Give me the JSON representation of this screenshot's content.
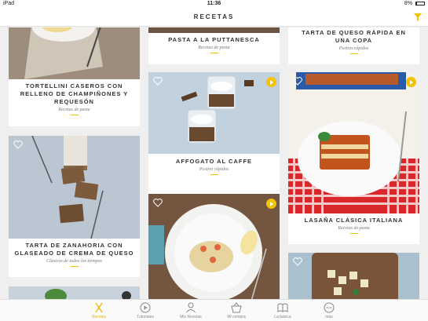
{
  "status": {
    "carrier": "iPad",
    "time": "11:36",
    "battery": "8%"
  },
  "nav": {
    "title": "RECETAS"
  },
  "cards": [
    {
      "title": "TORTELLINI CASEROS CON RELLENO DE CHAMPIÑONES Y REQUESÓN",
      "category": "Recetas de pasta"
    },
    {
      "title": "TARTA DE ZANAHORIA CON GLASEADO DE CREMA DE QUESO",
      "category": "Clásicos de todos los tiempos"
    },
    {
      "title": "PASTA A LA PUTTANESCA",
      "category": "Recetas de pasta"
    },
    {
      "title": "AFFOGATO AL CAFFE",
      "category": "Postres rápidos"
    },
    {
      "title": "TARTA DE QUESO RÁPIDA EN UNA COPA",
      "category": "Postres rápidos"
    },
    {
      "title": "LASAÑA CLÁSICA ITALIANA",
      "category": "Recetas de pasta"
    }
  ],
  "tabs": [
    {
      "label": "Recetas",
      "icon": "fork-knife-icon",
      "active": true
    },
    {
      "label": "Tutoriales",
      "icon": "play-icon"
    },
    {
      "label": "Mis Recetas",
      "icon": "person-icon"
    },
    {
      "label": "Mi compra",
      "icon": "basket-icon"
    },
    {
      "label": "La básica",
      "icon": "book-icon"
    },
    {
      "label": "más",
      "icon": "more-icon"
    }
  ],
  "colors": {
    "accent": "#f2c400",
    "tab_active": "#e8b800"
  }
}
